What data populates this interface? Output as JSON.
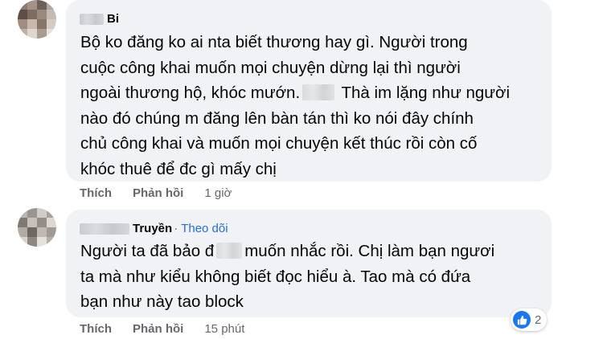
{
  "comments": [
    {
      "author_suffix": "Bi",
      "text_before": "Bộ ko đăng ko ai nta biết thương hay gì. Người trong\ncuộc công khai muốn mọi chuyện dừng lại thì người\nngoài thương hộ, khóc mướn.",
      "text_after": " Thà im lặng như người\nnào đó chúng m đăng lên bàn tán thì ko nói đây chính\nchủ công khai và muốn mọi chuyện kết thúc rồi còn cố\nkhóc thuê để đc gì mấy chị",
      "like_label": "Thích",
      "reply_label": "Phản hồi",
      "time": "1 giờ"
    },
    {
      "author_suffix": "Truyền",
      "follow_separator": "·",
      "follow_label": "Theo dõi",
      "text_before": "Người ta đã bảo đ",
      "text_after": "muốn nhắc rồi. Chị làm bạn ngươi\nta mà như kiểu không biết đọc hiểu à. Tao mà có đứa\nbạn như này tao block",
      "like_label": "Thích",
      "reply_label": "Phản hồi",
      "time": "15 phút",
      "reaction_count": "2"
    }
  ],
  "colors": {
    "bubble": "#f0f2f5",
    "meta": "#65676b",
    "link": "#216fdb",
    "like": "#1877f2"
  }
}
